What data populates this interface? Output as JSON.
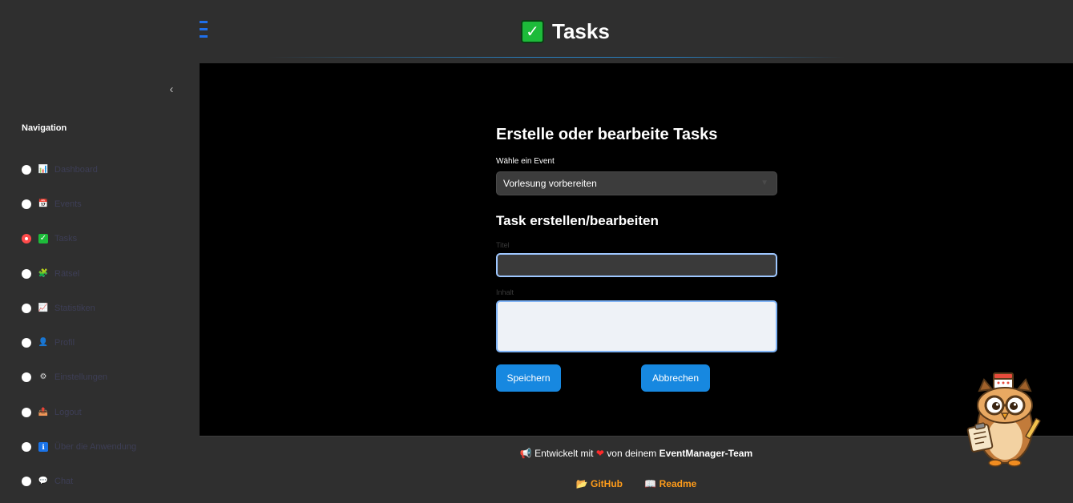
{
  "sidebar": {
    "collapse_icon": "chevron-left-icon",
    "nav_title": "Navigation",
    "items": [
      {
        "label": "Dashboard",
        "icon": "bar-chart-icon",
        "glyph": "📊",
        "active": false
      },
      {
        "label": "Events",
        "icon": "calendar-icon",
        "glyph": "📅",
        "active": false
      },
      {
        "label": "Tasks",
        "icon": "checkmark-icon",
        "glyph": "✅",
        "active": true
      },
      {
        "label": "Rätsel",
        "icon": "puzzle-icon",
        "glyph": "🧩",
        "active": false
      },
      {
        "label": "Statistiken",
        "icon": "trend-chart-icon",
        "glyph": "📈",
        "active": false
      },
      {
        "label": "Profil",
        "icon": "user-icon",
        "glyph": "👤",
        "active": false
      },
      {
        "label": "Einstellungen",
        "icon": "gear-icon",
        "glyph": "⚙",
        "active": false
      },
      {
        "label": "Logout",
        "icon": "logout-icon",
        "glyph": "📤",
        "active": false
      },
      {
        "label": "Über die Anwendung",
        "icon": "info-icon",
        "glyph": "ℹ",
        "active": false
      },
      {
        "label": "Chat",
        "icon": "speech-bubble-icon",
        "glyph": "💬",
        "active": false
      }
    ]
  },
  "header": {
    "title": "Tasks",
    "title_icon": "checkmark-icon"
  },
  "main": {
    "heading": "Erstelle oder bearbeite Tasks",
    "event_select_label": "Wähle ein Event",
    "event_select_value": "Vorlesung vorbereiten",
    "subheading": "Task erstellen/bearbeiten",
    "title_label": "Titel",
    "title_value": "",
    "content_label": "Inhalt",
    "content_value": "",
    "save_label": "Speichern",
    "cancel_label": "Abbrechen"
  },
  "footer": {
    "text_before": "Entwickelt mit",
    "text_middle": "von deinem",
    "team": "EventManager-Team",
    "github": "GitHub",
    "readme": "Readme"
  },
  "colors": {
    "accent": "#1788e0",
    "active_radio": "#ff4b4b",
    "footer_link": "#ff9c1a",
    "background": "#2f2f2f",
    "main_background": "#000000"
  }
}
